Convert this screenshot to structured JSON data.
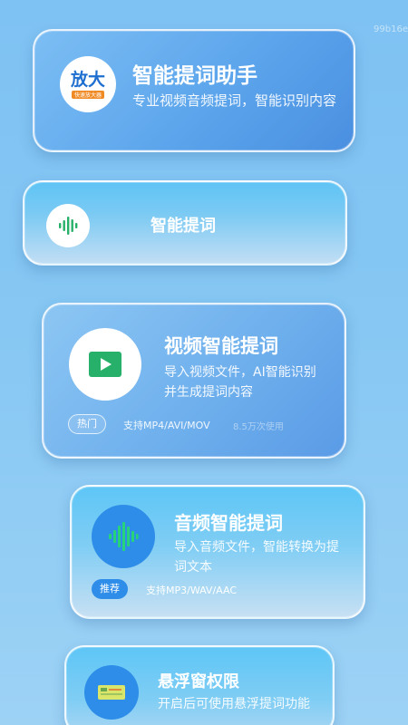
{
  "watermark": "99b16e",
  "header_card": {
    "logo_text": "放大",
    "logo_subtext": "快速放大器",
    "title": "智能提词助手",
    "description": "专业视频音频提词，智能识别内容"
  },
  "mini_card": {
    "icon": "audio-wave-icon",
    "title": "智能提词"
  },
  "video_card": {
    "icon": "play-video-icon",
    "title": "视频智能提词",
    "description": "导入视频文件，AI智能识别并生成提词内容",
    "badge": "热门",
    "formats": "支持MP4/AVI/MOV",
    "usage": "8.5万次使用"
  },
  "audio_card": {
    "icon": "sound-wave-icon",
    "title": "音频智能提词",
    "description": "导入音频文件，智能转换为提词文本",
    "badge": "推荐",
    "formats": "支持MP3/WAV/AAC"
  },
  "float_card": {
    "icon": "floating-window-icon",
    "title": "悬浮窗权限",
    "description": "开启后可使用悬浮提词功能"
  },
  "colors": {
    "accent_blue": "#2d8de8",
    "green": "#27b06a"
  }
}
